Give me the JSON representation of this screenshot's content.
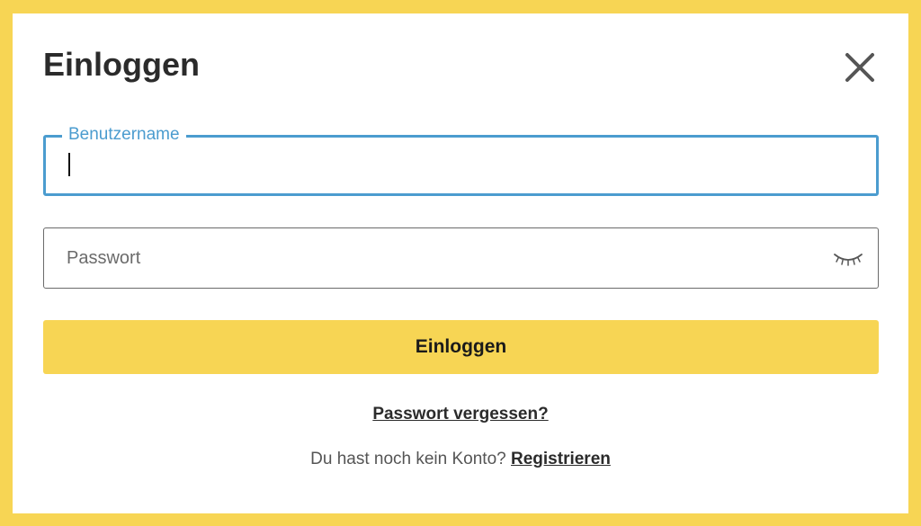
{
  "modal": {
    "title": "Einloggen",
    "close_icon": "close-icon"
  },
  "username": {
    "label": "Benutzername",
    "value": ""
  },
  "password": {
    "placeholder": "Passwort",
    "value": "",
    "toggle_icon": "eye-closed-icon"
  },
  "login_button": {
    "label": "Einloggen"
  },
  "forgot_password": {
    "label": "Passwort vergessen?"
  },
  "register": {
    "prompt": "Du hast noch kein Konto?",
    "link_label": "Registrieren"
  },
  "colors": {
    "accent_yellow": "#f7d554",
    "focus_blue": "#4b9ccf",
    "text_dark": "#2b2b2b"
  }
}
